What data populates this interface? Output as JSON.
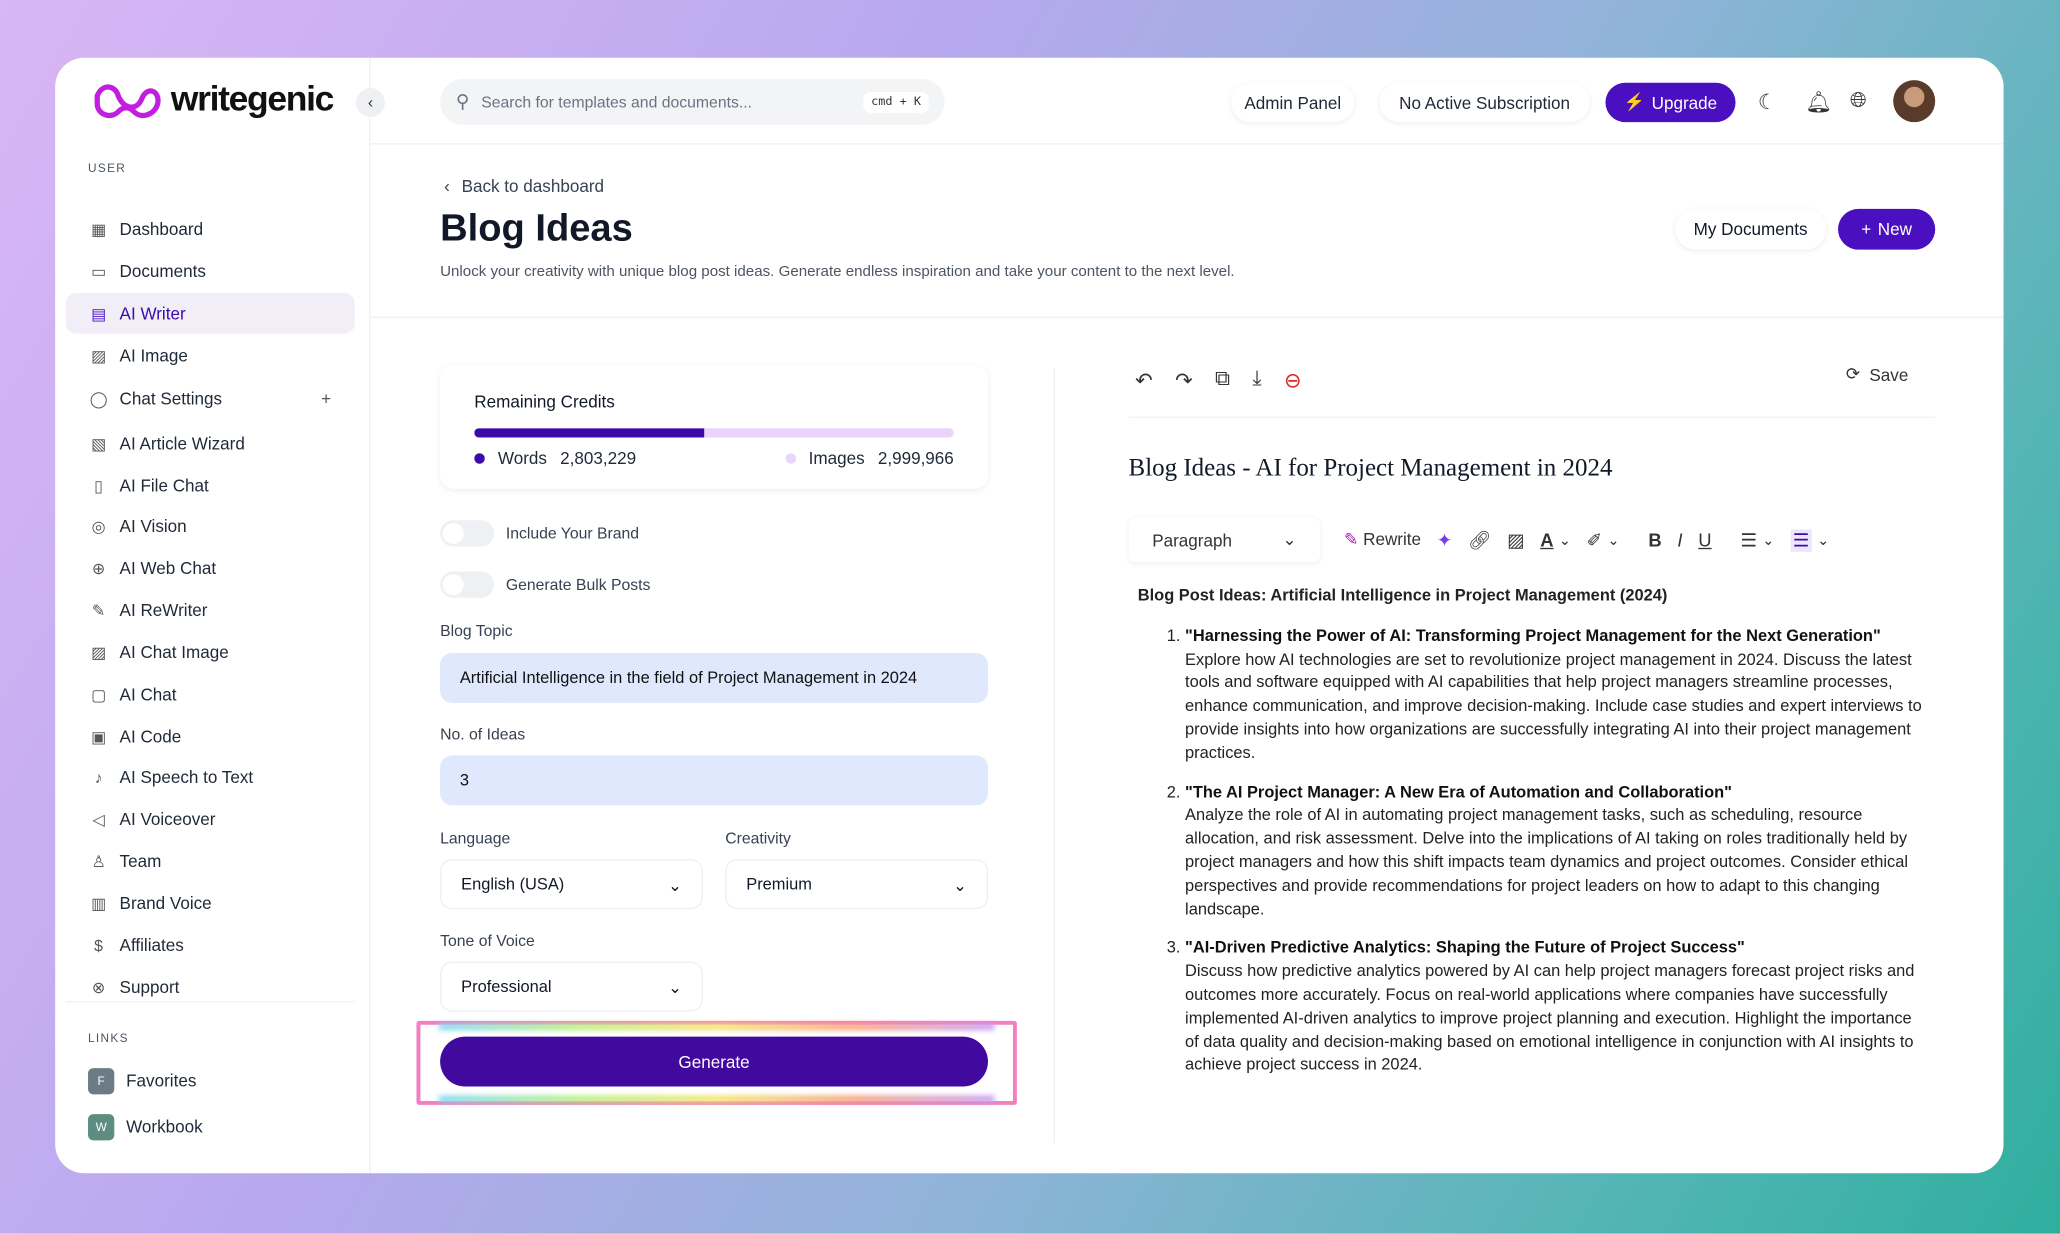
{
  "brand": {
    "name": "writegenic",
    "accent": "#4a0fbf"
  },
  "search": {
    "placeholder": "Search for templates and documents...",
    "shortcut": "cmd + K"
  },
  "header": {
    "admin_panel": "Admin Panel",
    "subscription": "No Active Subscription",
    "upgrade": "Upgrade"
  },
  "sidebar": {
    "section_user": "USER",
    "items": [
      {
        "label": "Dashboard",
        "icon": "grid-icon"
      },
      {
        "label": "Documents",
        "icon": "archive-icon"
      },
      {
        "label": "AI Writer",
        "icon": "document-icon",
        "active": true
      },
      {
        "label": "AI Image",
        "icon": "image-icon"
      },
      {
        "label": "Chat Settings",
        "icon": "chat-icon"
      },
      {
        "label": "AI Article Wizard",
        "icon": "article-icon"
      },
      {
        "label": "AI File Chat",
        "icon": "file-icon"
      },
      {
        "label": "AI Vision",
        "icon": "vision-icon"
      },
      {
        "label": "AI Web Chat",
        "icon": "globe-icon"
      },
      {
        "label": "AI ReWriter",
        "icon": "pen-icon"
      },
      {
        "label": "AI Chat Image",
        "icon": "image-icon"
      },
      {
        "label": "AI Chat",
        "icon": "message-icon"
      },
      {
        "label": "AI Code",
        "icon": "terminal-icon"
      },
      {
        "label": "AI Speech to Text",
        "icon": "mic-icon"
      },
      {
        "label": "AI Voiceover",
        "icon": "speaker-icon"
      },
      {
        "label": "Team",
        "icon": "user-plus-icon"
      },
      {
        "label": "Brand Voice",
        "icon": "book-icon"
      },
      {
        "label": "Affiliates",
        "icon": "dollar-icon"
      },
      {
        "label": "Support",
        "icon": "lifebuoy-icon"
      }
    ],
    "section_links": "LINKS",
    "links": [
      {
        "badge": "F",
        "label": "Favorites"
      },
      {
        "badge": "W",
        "label": "Workbook"
      }
    ]
  },
  "page": {
    "back": "Back to dashboard",
    "title": "Blog Ideas",
    "description": "Unlock your creativity with unique blog post ideas. Generate endless inspiration and take your content to the next level.",
    "my_documents": "My Documents",
    "new": "New"
  },
  "credits": {
    "title": "Remaining Credits",
    "words_label": "Words",
    "words": "2,803,229",
    "images_label": "Images",
    "images": "2,999,966",
    "words_fill_percent": 48
  },
  "form": {
    "include_brand": "Include Your Brand",
    "bulk_posts": "Generate Bulk Posts",
    "topic_label": "Blog Topic",
    "topic": "Artificial Intelligence in the field of Project Management in 2024",
    "ideas_label": "No. of Ideas",
    "ideas": "3",
    "language_label": "Language",
    "language": "English (USA)",
    "creativity_label": "Creativity",
    "creativity": "Premium",
    "tone_label": "Tone of Voice",
    "tone": "Professional",
    "generate": "Generate"
  },
  "editor": {
    "save": "Save",
    "doc_title": "Blog Ideas - AI for Project Management in 2024",
    "block_type": "Paragraph",
    "rewrite": "Rewrite",
    "heading": "Blog Post Ideas: Artificial Intelligence in Project Management (2024)",
    "ideas": [
      {
        "title": "\"Harnessing the Power of AI: Transforming Project Management for the Next Generation\"",
        "body": "Explore how AI technologies are set to revolutionize project management in 2024. Discuss the latest tools and software equipped with AI capabilities that help project managers streamline processes, enhance communication, and improve decision-making. Include case studies and expert interviews to provide insights into how organizations are successfully integrating AI into their project management practices."
      },
      {
        "title": "\"The AI Project Manager: A New Era of Automation and Collaboration\"",
        "body": "Analyze the role of AI in automating project management tasks, such as scheduling, resource allocation, and risk assessment. Delve into the implications of AI taking on roles traditionally held by project managers and how this shift impacts team dynamics and project outcomes. Consider ethical perspectives and provide recommendations for project leaders on how to adapt to this changing landscape."
      },
      {
        "title": "\"AI-Driven Predictive Analytics: Shaping the Future of Project Success\"",
        "body": "Discuss how predictive analytics powered by AI can help project managers forecast project risks and outcomes more accurately. Focus on real-world applications where companies have successfully implemented AI-driven analytics to improve project planning and execution. Highlight the importance of data quality and decision-making based on emotional intelligence in conjunction with AI insights to achieve project success in 2024."
      }
    ]
  }
}
